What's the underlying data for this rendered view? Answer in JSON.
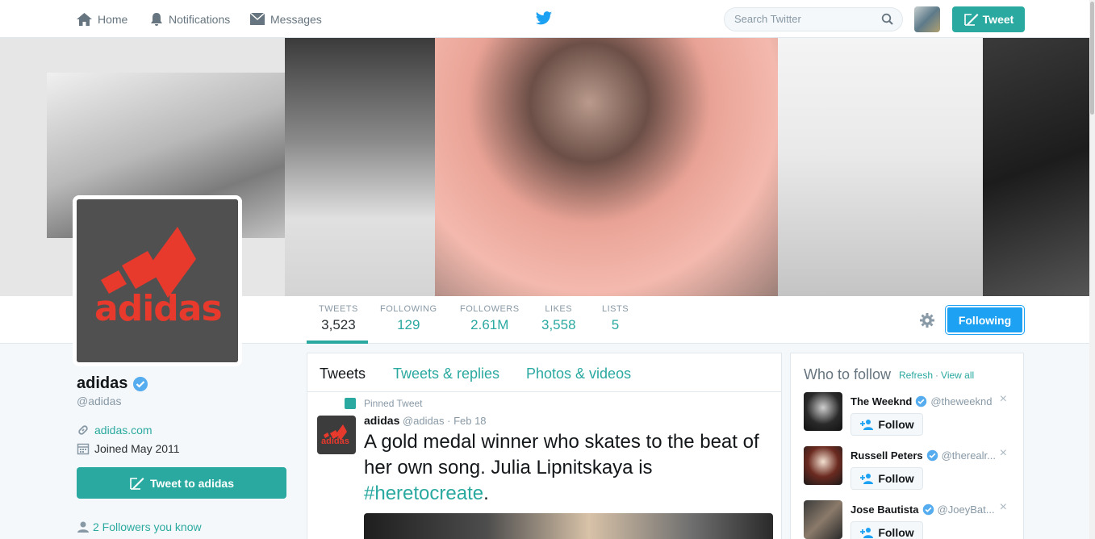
{
  "nav": {
    "home": "Home",
    "notifications": "Notifications",
    "messages": "Messages",
    "search_placeholder": "Search Twitter",
    "tweet_button": "Tweet"
  },
  "profile": {
    "name": "adidas",
    "handle": "@adidas",
    "website": "adidas.com",
    "joined": "Joined May 2011",
    "tweet_to_button": "Tweet to adidas",
    "followers_you_know": "2 Followers you know",
    "avatar_logo_text": "adidas"
  },
  "stats": [
    {
      "label": "TWEETS",
      "value": "3,523"
    },
    {
      "label": "FOLLOWING",
      "value": "129"
    },
    {
      "label": "FOLLOWERS",
      "value": "2.61M"
    },
    {
      "label": "LIKES",
      "value": "3,558"
    },
    {
      "label": "LISTS",
      "value": "5"
    }
  ],
  "following_button": "Following",
  "timeline": {
    "tabs": [
      "Tweets",
      "Tweets & replies",
      "Photos & videos"
    ],
    "pinned_label": "Pinned Tweet",
    "tweet": {
      "name": "adidas",
      "handle": "@adidas",
      "date": "· Feb 18",
      "text": "A gold medal winner who skates to the beat of her own song. Julia Lipnitskaya is ",
      "hashtag": "#heretocreate",
      "end": "."
    }
  },
  "who_to_follow": {
    "title": "Who to follow",
    "refresh": "Refresh",
    "separator": "·",
    "view_all": "View all",
    "follow_label": "Follow",
    "close": "×",
    "suggestions": [
      {
        "name": "The Weeknd",
        "handle": "@theweeknd"
      },
      {
        "name": "Russell Peters",
        "handle": "@therealr..."
      },
      {
        "name": "Jose Bautista",
        "handle": "@JoeyBat..."
      }
    ]
  },
  "colors": {
    "accent": "#2aa9a0",
    "following_blue": "#1da1f2",
    "verified_blue": "#55acee",
    "adidas_red": "#e8392d"
  }
}
